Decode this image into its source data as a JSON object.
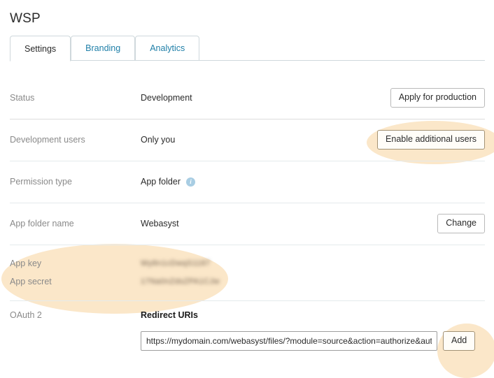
{
  "page": {
    "title": "WSP"
  },
  "tabs": [
    {
      "label": "Settings",
      "active": true
    },
    {
      "label": "Branding",
      "active": false
    },
    {
      "label": "Analytics",
      "active": false
    }
  ],
  "rows": {
    "status": {
      "label": "Status",
      "value": "Development",
      "action": "Apply for production"
    },
    "development_users": {
      "label": "Development users",
      "value": "Only you",
      "action": "Enable additional users"
    },
    "permission_type": {
      "label": "Permission type",
      "value": "App folder",
      "info_icon": "info-icon"
    },
    "app_folder_name": {
      "label": "App folder name",
      "value": "Webasyst",
      "action": "Change"
    },
    "app_key": {
      "label": "App key",
      "value": "Wy8n1cDwqS1187"
    },
    "app_secret": {
      "label": "App secret",
      "value": "17Na0nZdsZPA1CJw"
    },
    "oauth": {
      "label": "OAuth 2",
      "heading": "Redirect URIs",
      "uri_value": "https://mydomain.com/webasyst/files/?module=source&action=authorize&authorize",
      "add_label": "Add"
    }
  },
  "colors": {
    "highlight": "#fbe7c9",
    "tab_link": "#1f7fa8",
    "divider": "#e4eaec",
    "label": "#8a8a8a",
    "info_icon": "#a8cde3"
  }
}
